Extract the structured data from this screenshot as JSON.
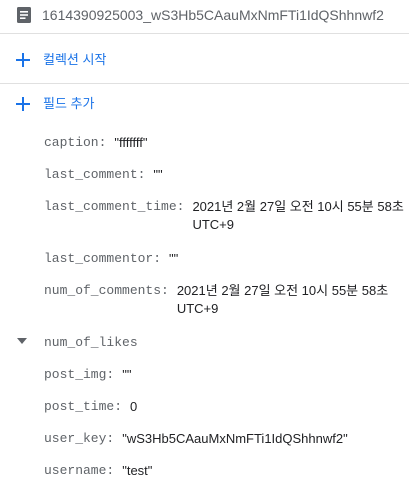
{
  "header": {
    "doc_id": "1614390925003_wS3Hb5CAauMxNmFTi1IdQShhnwf2",
    "icon": "document-icon"
  },
  "actions": {
    "start_collection": "컬렉션 시작",
    "add_field": "필드 추가"
  },
  "fields": [
    {
      "key": "caption:",
      "value": "\"fffffff\""
    },
    {
      "key": "last_comment:",
      "value": "\"\""
    },
    {
      "key": "last_comment_time:",
      "value": "2021년 2월 27일 오전 10시 55분 58초 UTC+9"
    },
    {
      "key": "last_commentor:",
      "value": "\"\""
    },
    {
      "key": "num_of_comments:",
      "value": "2021년 2월 27일 오전 10시 55분 58초 UTC+9"
    },
    {
      "key": "num_of_likes",
      "value": ""
    },
    {
      "key": "post_img:",
      "value": "\"\""
    },
    {
      "key": "post_time:",
      "value": "0"
    },
    {
      "key": "user_key:",
      "value": "\"wS3Hb5CAauMxNmFTi1IdQShhnwf2\""
    },
    {
      "key": "username:",
      "value": "\"test\""
    }
  ],
  "colors": {
    "accent": "#1a73e8",
    "key_text": "#5f6368",
    "value_text": "#202124",
    "divider": "#e0e0e0"
  }
}
